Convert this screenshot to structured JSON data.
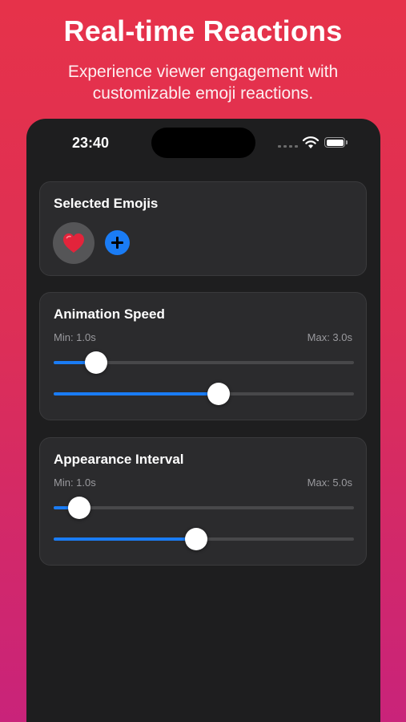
{
  "promo": {
    "headline": "Real-time Reactions",
    "subline": "Experience viewer engagement with customizable emoji reactions."
  },
  "status_bar": {
    "time": "23:40"
  },
  "selected_emojis": {
    "title": "Selected Emojis",
    "emojis": [
      "❤️"
    ],
    "add_icon": "plus-circle-icon"
  },
  "animation_speed": {
    "title": "Animation Speed",
    "min_label": "Min: 1.0s",
    "max_label": "Max: 3.0s",
    "min_slider_fraction": 0.14,
    "max_slider_fraction": 0.55
  },
  "appearance_interval": {
    "title": "Appearance Interval",
    "min_label": "Min: 1.0s",
    "max_label": "Max: 5.0s",
    "min_slider_fraction": 0.085,
    "max_slider_fraction": 0.475
  },
  "colors": {
    "accent": "#1a7cf5",
    "card_background": "#2b2b2d",
    "screen_background": "#1e1e1f",
    "gradient_top": "#e6324a",
    "gradient_bottom": "#c9237a"
  }
}
